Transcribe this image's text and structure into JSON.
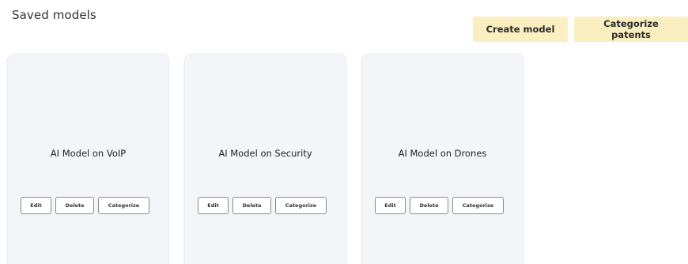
{
  "page": {
    "title": "Saved models"
  },
  "header": {
    "create_model_label": "Create model",
    "categorize_patents_label": "Categorize patents",
    "button_color": "#fbeec0"
  },
  "cards": [
    {
      "title": "AI Model on VoIP",
      "edit_label": "Edit",
      "delete_label": "Delete",
      "categorize_label": "Categorize"
    },
    {
      "title": "AI Model on Security",
      "edit_label": "Edit",
      "delete_label": "Delete",
      "categorize_label": "Categorize"
    },
    {
      "title": "AI Model on Drones",
      "edit_label": "Edit",
      "delete_label": "Delete",
      "categorize_label": "Categorize"
    }
  ]
}
